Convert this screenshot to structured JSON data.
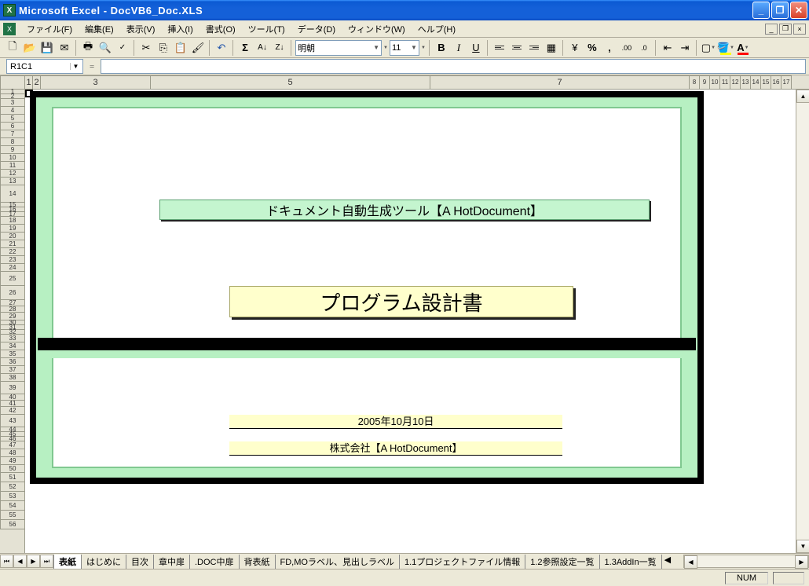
{
  "window": {
    "title": "Microsoft Excel - DocVB6_Doc.XLS"
  },
  "menu": {
    "items": [
      "ファイル(F)",
      "編集(E)",
      "表示(V)",
      "挿入(I)",
      "書式(O)",
      "ツール(T)",
      "データ(D)",
      "ウィンドウ(W)",
      "ヘルプ(H)"
    ]
  },
  "toolbar": {
    "font_name": "明朝",
    "font_size": "11"
  },
  "name_box": {
    "reference": "R1C1",
    "formula_prefix": "="
  },
  "column_headers": {
    "col1": "1",
    "col2": "2",
    "col3": "3",
    "col4": "5",
    "col5": "7",
    "small": [
      "8",
      "9",
      "10",
      "11",
      "12",
      "13",
      "14",
      "15",
      "16",
      "17"
    ]
  },
  "row_headers": [
    "1",
    "2",
    "3",
    "4",
    "5",
    "6",
    "7",
    "8",
    "9",
    "10",
    "11",
    "12",
    "13",
    "14",
    "15",
    "16",
    "17",
    "18",
    "19",
    "20",
    "21",
    "22",
    "23",
    "24",
    "25",
    "26",
    "27",
    "28",
    "29",
    "30",
    "31",
    "32",
    "33",
    "34",
    "35",
    "36",
    "37",
    "38",
    "39",
    "40",
    "41",
    "42",
    "43",
    "44",
    "45",
    "46",
    "47",
    "48",
    "49",
    "50",
    "51",
    "52",
    "53",
    "54",
    "55",
    "56"
  ],
  "document": {
    "tool_title": "ドキュメント自動生成ツール【A HotDocument】",
    "doc_title": "プログラム設計書",
    "date": "2005年10月10日",
    "company": "株式会社【A HotDocument】"
  },
  "tabs": {
    "active": "表紙",
    "others": [
      "はじめに",
      "目次",
      "章中扉",
      ".DOC中扉",
      "背表紙",
      "FD,MOラベル、見出しラベル",
      "1.1プロジェクトファイル情報",
      "1.2参照設定一覧",
      "1.3AddIn一覧"
    ]
  },
  "status": {
    "num_lock": "NUM"
  }
}
